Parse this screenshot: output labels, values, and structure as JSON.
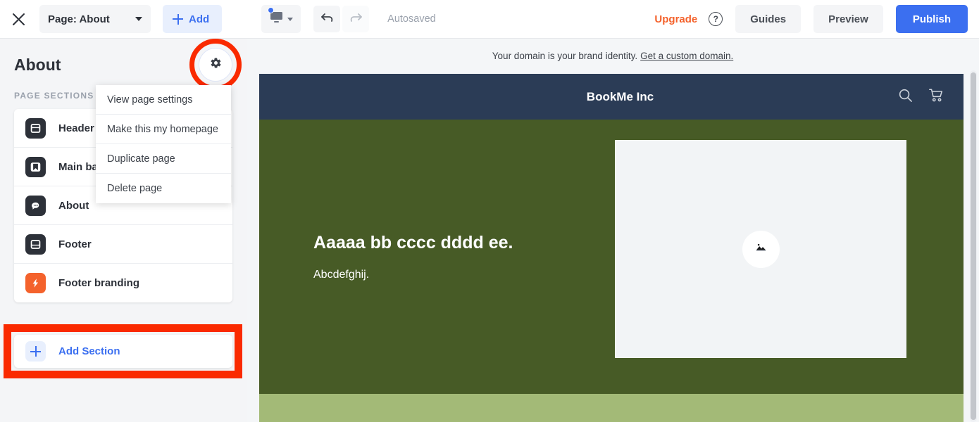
{
  "toolbar": {
    "close_icon": "close-icon",
    "page_selector": {
      "label": "Page: About",
      "caret_icon": "chevron-down-icon"
    },
    "add_button": {
      "label": "Add",
      "icon": "plus-icon"
    },
    "device_button": {
      "icon": "desktop-icon",
      "caret_icon": "chevron-down-icon",
      "badge": "notification-dot"
    },
    "undo_icon": "undo-icon",
    "redo_icon": "redo-icon",
    "autosaved": "Autosaved",
    "upgrade": "Upgrade",
    "help_icon": "help-circle-icon",
    "help_glyph": "?",
    "guides": "Guides",
    "preview": "Preview",
    "publish": "Publish",
    "accent_blue": "#3b6ff0",
    "upgrade_orange": "#f4622c"
  },
  "sidebar": {
    "title": "About",
    "gear_icon": "gear-icon",
    "sections_label": "PAGE SECTIONS",
    "items": [
      {
        "label": "Header",
        "icon": "header-layout-icon",
        "color": "#2d3139"
      },
      {
        "label": "Main banner",
        "icon": "bookmark-icon",
        "color": "#2d3139"
      },
      {
        "label": "About",
        "icon": "speech-bubble-icon",
        "color": "#2d3139"
      },
      {
        "label": "Footer",
        "icon": "footer-layout-icon",
        "color": "#2d3139"
      },
      {
        "label": "Footer branding",
        "icon": "lightning-bolt-icon",
        "color": "#f4622c"
      }
    ],
    "add_section": {
      "label": "Add Section",
      "icon": "plus-icon"
    },
    "highlight_color": "#fa2a00"
  },
  "dropdown": {
    "items": [
      {
        "label": "View page settings"
      },
      {
        "label": "Make this my homepage"
      },
      {
        "label": "Duplicate page"
      },
      {
        "label": "Delete page"
      }
    ]
  },
  "preview": {
    "domain_notice": "Your domain is your brand identity.",
    "domain_link": "Get a custom domain.",
    "site": {
      "brand": "BookMe Inc",
      "search_icon": "search-icon",
      "cart_icon": "shopping-cart-icon",
      "header_color": "#2b3c56",
      "hero_color": "#475b26",
      "band_color": "#a3ba77",
      "heading": "Aaaaa bb cccc dddd ee.",
      "paragraph": "Abcdefghij.",
      "image_placeholder_icon": "image-placeholder-icon"
    },
    "scrollbar": "vertical-scrollbar"
  }
}
